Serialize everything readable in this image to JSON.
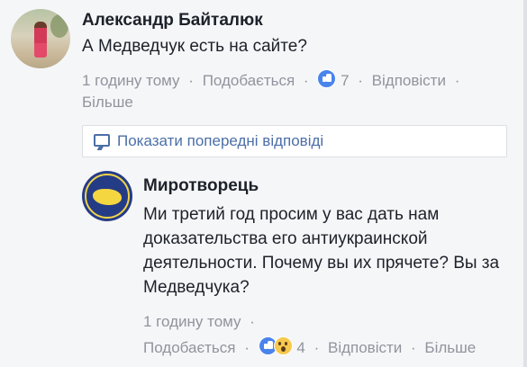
{
  "comment1": {
    "author": "Александр Байталюк",
    "text": "А Медведчук есть на сайте?",
    "time": "1 годину тому",
    "sep": "·",
    "like": "Подобається",
    "reaction_count": "7",
    "reply": "Відповісти",
    "more": "Більше"
  },
  "show_previous": {
    "label": "Показати попередні відповіді"
  },
  "comment2": {
    "author": "Миротворець",
    "text": "Ми третий год просим у вас дать нам доказательства его антиукраинской деятельности. Почему вы их прячете? Вы за Медведчука?",
    "time": "1 годину тому",
    "sep": "·",
    "like": "Подобається",
    "reaction_count": "4",
    "reply": "Відповісти",
    "more": "Більше"
  },
  "colors": {
    "link_blue": "#4b6fa8",
    "meta_gray": "#90949c",
    "like_blue": "#4a83ec"
  },
  "icons": [
    "like-icon",
    "wow-icon",
    "comment-bubble-icon"
  ]
}
